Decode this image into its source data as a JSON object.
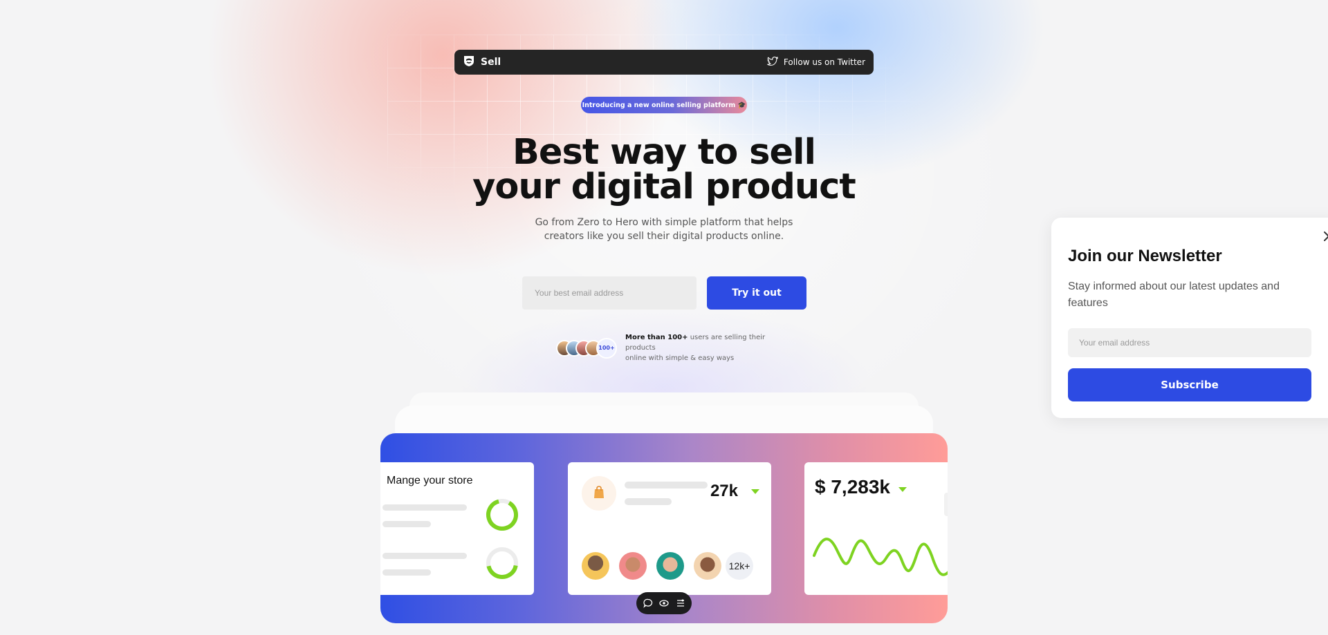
{
  "nav": {
    "brand": "Sell",
    "twitter_label": "Follow us on Twitter"
  },
  "hero": {
    "badge": "Introducing a new online selling platform 🎓",
    "headline_line1": "Best way to sell",
    "headline_line2": "your digital product",
    "subtext_line1": "Go from Zero to Hero with simple platform that helps",
    "subtext_line2": "creators like you sell their digital products online.",
    "email_placeholder": "Your best email address",
    "cta_label": "Try it out",
    "users_count_badge": "100+",
    "users_bold": "More than 100+",
    "users_text_1": " users are selling their products",
    "users_text_2": "online with simple & easy ways"
  },
  "dashboard": {
    "store_title": "Mange your store",
    "sales_count": "27k",
    "customers_count": "12k+",
    "revenue": "$ 7,283k"
  },
  "newsletter": {
    "title": "Join our Newsletter",
    "subtitle": "Stay informed about our latest updates and features",
    "email_placeholder": "Your email address",
    "button_label": "Subscribe"
  },
  "colors": {
    "primary": "#2d4be3",
    "accent_green": "#7ed321",
    "topbar": "#252525"
  },
  "icons": {
    "brand": "shield-logo-icon",
    "twitter": "twitter-icon",
    "close": "close-icon",
    "bag": "shopping-bag-icon",
    "toolbar": [
      "comment-icon",
      "eye-icon",
      "list-settings-icon"
    ]
  }
}
